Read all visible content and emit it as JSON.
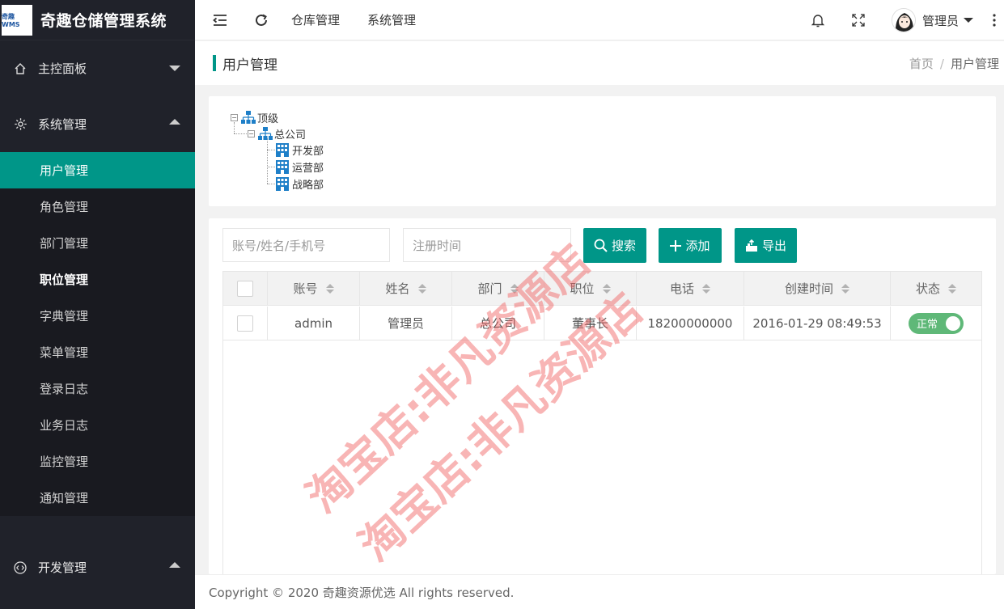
{
  "app": {
    "logo_text": "奇趣WMS",
    "title": "奇趣仓储管理系统"
  },
  "sidebar": {
    "groups": [
      {
        "label": "主控面板",
        "expanded": false
      },
      {
        "label": "系统管理",
        "expanded": true
      },
      {
        "label": "开发管理",
        "expanded": true
      }
    ],
    "items": [
      {
        "label": "用户管理",
        "active": true
      },
      {
        "label": "角色管理"
      },
      {
        "label": "部门管理"
      },
      {
        "label": "职位管理"
      },
      {
        "label": "字典管理"
      },
      {
        "label": "菜单管理"
      },
      {
        "label": "登录日志"
      },
      {
        "label": "业务日志"
      },
      {
        "label": "监控管理"
      },
      {
        "label": "通知管理"
      }
    ]
  },
  "header": {
    "menus": [
      "仓库管理",
      "系统管理"
    ],
    "user_name": "管理员"
  },
  "page": {
    "title": "用户管理",
    "breadcrumb": [
      "首页",
      "/",
      "用户管理"
    ]
  },
  "tree": {
    "root": "顶级",
    "company": "总公司",
    "departments": [
      "开发部",
      "运营部",
      "战略部"
    ]
  },
  "toolbar": {
    "search_placeholder": "账号/姓名/手机号",
    "date_placeholder": "注册时间",
    "search_label": "搜索",
    "add_label": "添加",
    "export_label": "导出"
  },
  "table": {
    "columns": [
      "账号",
      "姓名",
      "部门",
      "职位",
      "电话",
      "创建时间",
      "状态"
    ],
    "rows": [
      {
        "account": "admin",
        "name": "管理员",
        "dept": "总公司",
        "position": "董事长",
        "phone": "18200000000",
        "created": "2016-01-29 08:49:53",
        "status": "正常"
      }
    ]
  },
  "footer": {
    "copyright": "Copyright © 2020 奇趣资源优选 All rights reserved."
  },
  "watermark": {
    "text": "淘宝店:非凡资源店"
  },
  "colors": {
    "accent": "#009688",
    "sidebar_bg": "#20222a",
    "switch_on": "#5fb878",
    "watermark": "#f05a5a"
  }
}
